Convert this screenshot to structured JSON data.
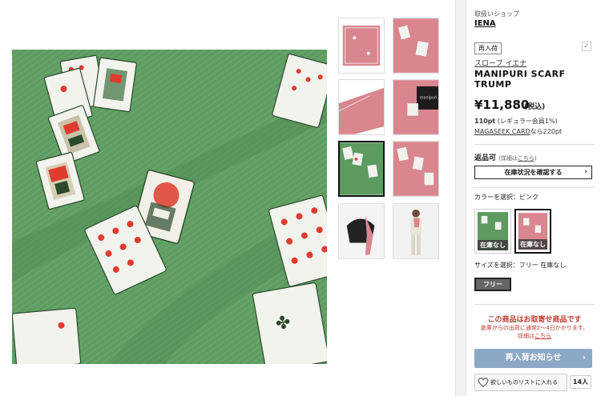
{
  "shop": {
    "label": "取扱いショップ",
    "name": "IENA"
  },
  "restock_tag": "再入荷",
  "brand": "スローブ イエナ",
  "product": {
    "name": "MANIPURI SCARF TRUMP",
    "price": "¥11,880",
    "tax": "(税込)",
    "points_value": "110pt",
    "points_note": "(レギュラー会員1%)",
    "magaseek_link": "MAGASEEK CARD",
    "magaseek_suffix": "なら220pt"
  },
  "returns": {
    "label": "返品可",
    "detail": "(詳細は",
    "detail_link": "こちら",
    "detail_end": ")"
  },
  "stock_button": "在庫状況を確認する",
  "color": {
    "label": "カラーを選択：ピンク",
    "swatches": [
      {
        "name": "green",
        "status": "在庫なし",
        "color": "#5c9a5f"
      },
      {
        "name": "pink",
        "status": "在庫なし",
        "color": "#d9868f"
      }
    ]
  },
  "size": {
    "label": "サイズを選択：フリー 在庫なし",
    "option": "フリー"
  },
  "notice": {
    "title": "この商品はお取寄せ商品です",
    "line1": "倉庫からの出荷に通常2～4日かかります。",
    "line2_prefix": "詳細は",
    "line2_link": "こちら"
  },
  "notify_button": "再入荷お知らせ",
  "wishlist": {
    "label": "欲しいものリストに入れる",
    "count": "14人"
  },
  "colors": {
    "accent_blue": "#8da7c7",
    "alert_red": "#c0392b",
    "scarf_green": "#5c9a5f",
    "scarf_pink": "#d9868f"
  }
}
